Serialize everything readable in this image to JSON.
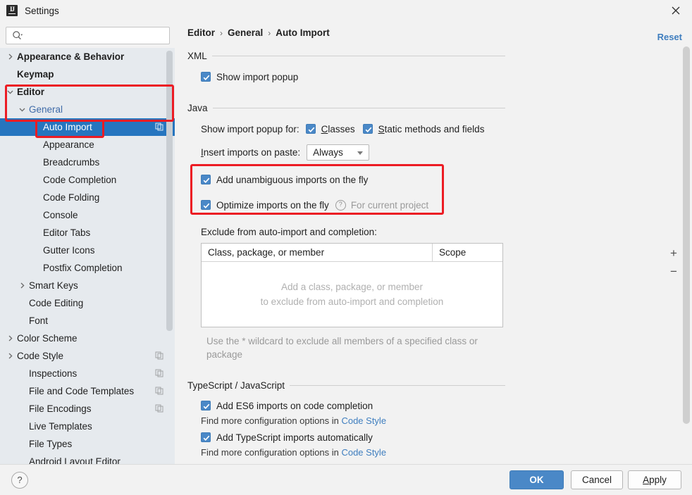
{
  "window": {
    "title": "Settings",
    "app_icon": "intellij-idea-icon",
    "close_icon": "close-icon"
  },
  "search": {
    "value": "",
    "placeholder": "",
    "icon": "search-icon"
  },
  "sidebar": {
    "items": [
      {
        "label": "Appearance & Behavior",
        "indent": 0,
        "arrow": "collapsed",
        "bold": true,
        "modified": false,
        "selected": false,
        "copy_icon": false
      },
      {
        "label": "Keymap",
        "indent": 0,
        "arrow": "none",
        "bold": true,
        "modified": false,
        "selected": false,
        "copy_icon": false
      },
      {
        "label": "Editor",
        "indent": 0,
        "arrow": "expanded",
        "bold": true,
        "modified": false,
        "selected": false,
        "copy_icon": false
      },
      {
        "label": "General",
        "indent": 1,
        "arrow": "expanded",
        "bold": false,
        "modified": true,
        "selected": false,
        "copy_icon": false
      },
      {
        "label": "Auto Import",
        "indent": 2,
        "arrow": "none",
        "bold": false,
        "modified": false,
        "selected": true,
        "copy_icon": true
      },
      {
        "label": "Appearance",
        "indent": 2,
        "arrow": "none",
        "bold": false,
        "modified": false,
        "selected": false,
        "copy_icon": false
      },
      {
        "label": "Breadcrumbs",
        "indent": 2,
        "arrow": "none",
        "bold": false,
        "modified": false,
        "selected": false,
        "copy_icon": false
      },
      {
        "label": "Code Completion",
        "indent": 2,
        "arrow": "none",
        "bold": false,
        "modified": false,
        "selected": false,
        "copy_icon": false
      },
      {
        "label": "Code Folding",
        "indent": 2,
        "arrow": "none",
        "bold": false,
        "modified": false,
        "selected": false,
        "copy_icon": false
      },
      {
        "label": "Console",
        "indent": 2,
        "arrow": "none",
        "bold": false,
        "modified": false,
        "selected": false,
        "copy_icon": false
      },
      {
        "label": "Editor Tabs",
        "indent": 2,
        "arrow": "none",
        "bold": false,
        "modified": false,
        "selected": false,
        "copy_icon": false
      },
      {
        "label": "Gutter Icons",
        "indent": 2,
        "arrow": "none",
        "bold": false,
        "modified": false,
        "selected": false,
        "copy_icon": false
      },
      {
        "label": "Postfix Completion",
        "indent": 2,
        "arrow": "none",
        "bold": false,
        "modified": false,
        "selected": false,
        "copy_icon": false
      },
      {
        "label": "Smart Keys",
        "indent": 1,
        "arrow": "collapsed",
        "bold": false,
        "modified": false,
        "selected": false,
        "copy_icon": false
      },
      {
        "label": "Code Editing",
        "indent": 1,
        "arrow": "none",
        "bold": false,
        "modified": false,
        "selected": false,
        "copy_icon": false
      },
      {
        "label": "Font",
        "indent": 1,
        "arrow": "none",
        "bold": false,
        "modified": false,
        "selected": false,
        "copy_icon": false
      },
      {
        "label": "Color Scheme",
        "indent": 0,
        "arrow": "collapsed",
        "bold": false,
        "modified": false,
        "selected": false,
        "copy_icon": false
      },
      {
        "label": "Code Style",
        "indent": 0,
        "arrow": "collapsed",
        "bold": false,
        "modified": false,
        "selected": false,
        "copy_icon": true
      },
      {
        "label": "Inspections",
        "indent": 1,
        "arrow": "none",
        "bold": false,
        "modified": false,
        "selected": false,
        "copy_icon": true
      },
      {
        "label": "File and Code Templates",
        "indent": 1,
        "arrow": "none",
        "bold": false,
        "modified": false,
        "selected": false,
        "copy_icon": true
      },
      {
        "label": "File Encodings",
        "indent": 1,
        "arrow": "none",
        "bold": false,
        "modified": false,
        "selected": false,
        "copy_icon": true
      },
      {
        "label": "Live Templates",
        "indent": 1,
        "arrow": "none",
        "bold": false,
        "modified": false,
        "selected": false,
        "copy_icon": false
      },
      {
        "label": "File Types",
        "indent": 1,
        "arrow": "none",
        "bold": false,
        "modified": false,
        "selected": false,
        "copy_icon": false
      },
      {
        "label": "Android Layout Editor",
        "indent": 1,
        "arrow": "none",
        "bold": false,
        "modified": false,
        "selected": false,
        "copy_icon": false
      }
    ]
  },
  "content": {
    "breadcrumb": [
      "Editor",
      "General",
      "Auto Import"
    ],
    "breadcrumb_separator": "›",
    "reset_label": "Reset",
    "xml": {
      "title": "XML",
      "show_import_popup": {
        "label": "Show import popup",
        "checked": true
      }
    },
    "java": {
      "title": "Java",
      "show_import_popup_for_label": "Show import popup for:",
      "classes": {
        "label": "Classes",
        "mnemonic": "C",
        "checked": true
      },
      "static_methods": {
        "label": "Static methods and fields",
        "mnemonic": "S",
        "checked": true
      },
      "insert_imports_label": "Insert imports on paste:",
      "insert_imports_mnemonic": "I",
      "insert_imports_value": "Always",
      "add_unambiguous": {
        "label": "Add unambiguous imports on the fly",
        "checked": true
      },
      "optimize_imports": {
        "label": "Optimize imports on the fly",
        "checked": true,
        "help_icon": "help-icon",
        "scope_note": "For current project"
      },
      "exclude_label": "Exclude from auto-import and completion:",
      "table": {
        "columns": [
          "Class, package, or member",
          "Scope"
        ],
        "rows": [],
        "empty_line1": "Add a class, package, or member",
        "empty_line2": "to exclude from auto-import and completion",
        "add_button": "+",
        "remove_button": "−"
      },
      "wildcard_hint": "Use the * wildcard to exclude all members of a specified class or package"
    },
    "typescript": {
      "title": "TypeScript / JavaScript",
      "add_es6": {
        "label": "Add ES6 imports on code completion",
        "checked": true
      },
      "es6_hint_prefix": "Find more configuration options in ",
      "es6_hint_link": "Code Style",
      "add_ts": {
        "label": "Add TypeScript imports automatically",
        "checked": true
      },
      "ts_hint_prefix": "Find more configuration options in ",
      "ts_hint_link": "Code Style"
    }
  },
  "footer": {
    "help_label": "?",
    "ok_label": "OK",
    "cancel_label": "Cancel",
    "apply_label": "Apply",
    "apply_mnemonic": "A"
  },
  "colors": {
    "accent": "#4a88c7",
    "selection": "#2675bf",
    "link": "#3f7ebf",
    "annotation": "#ec1c24",
    "sidebar_bg": "#e6eaee",
    "panel_bg": "#f2f2f2"
  }
}
